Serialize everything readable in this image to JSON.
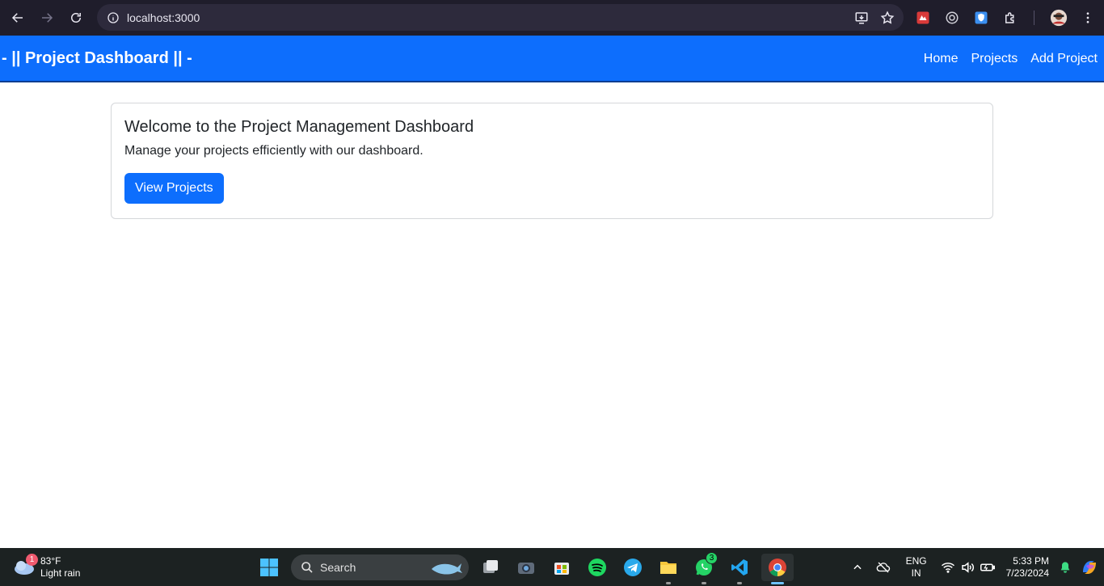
{
  "browser": {
    "url": "localhost:3000"
  },
  "navbar": {
    "brand": "- || Project Dashboard || -",
    "links": [
      "Home",
      "Projects",
      "Add Project"
    ],
    "color": "#0d6efd"
  },
  "card": {
    "title": "Welcome to the Project Management Dashboard",
    "text": "Manage your projects efficiently with our dashboard.",
    "button_label": "View Projects"
  },
  "taskbar": {
    "weather_temp": "83°F",
    "weather_desc": "Light rain",
    "weather_badge": "1",
    "search_label": "Search",
    "whatsapp_badge": "3",
    "lang_primary": "ENG",
    "lang_secondary": "IN",
    "time": "5:33 PM",
    "date": "7/23/2024"
  }
}
